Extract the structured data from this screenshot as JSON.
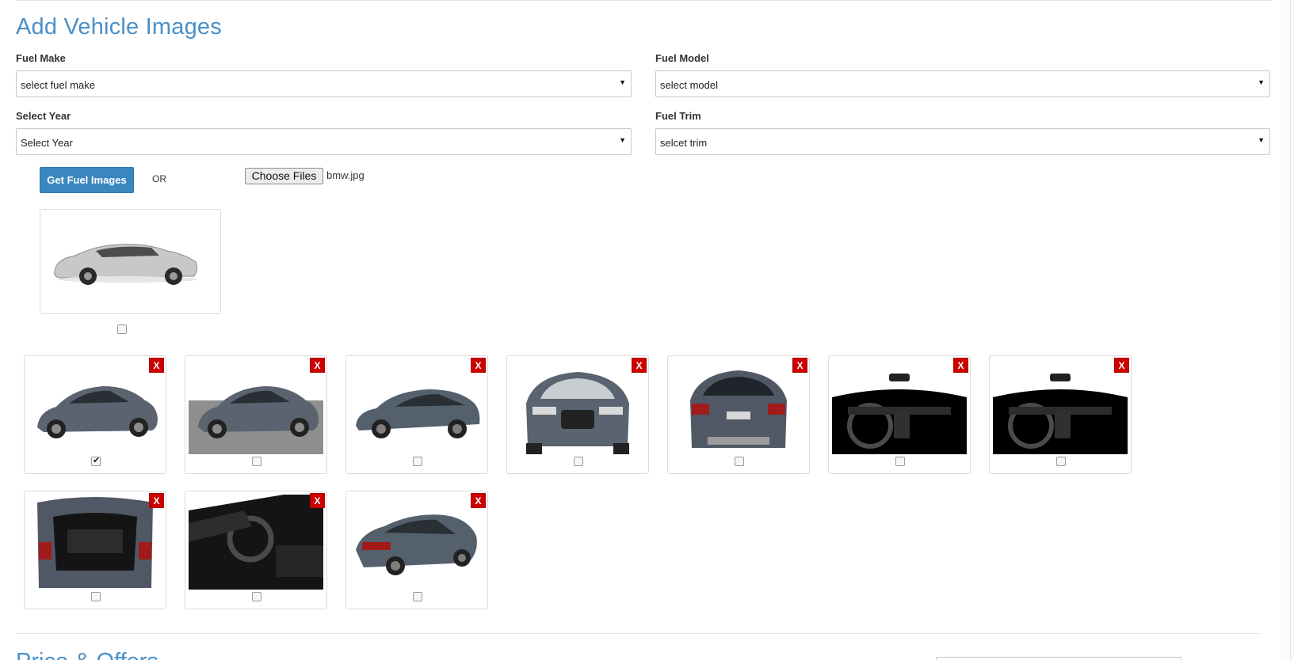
{
  "page": {
    "title": "Add Vehicle Images",
    "next_section_title": "Price & Offers"
  },
  "fields": {
    "make": {
      "label": "Fuel Make",
      "value": "select fuel make"
    },
    "model": {
      "label": "Fuel Model",
      "value": "select model"
    },
    "year": {
      "label": "Select Year",
      "value": "Select Year"
    },
    "trim": {
      "label": "Fuel Trim",
      "value": "selcet trim"
    }
  },
  "actions": {
    "get_images_label": "Get Fuel Images",
    "or_text": "OR",
    "choose_files_label": "Choose Files",
    "chosen_file": "bmw.jpg"
  },
  "icons": {
    "select_caret": "▼",
    "delete_label": "X"
  },
  "colors": {
    "accent": "#4a8fc7",
    "button": "#3a87c0",
    "delete": "#cc0000"
  },
  "uploaded_preview": {
    "checked": false
  },
  "thumbnails": [
    {
      "view": "front-three-quarter",
      "checked": true
    },
    {
      "view": "front-three-quarter-gray-bg",
      "checked": false
    },
    {
      "view": "side",
      "checked": false
    },
    {
      "view": "front",
      "checked": false
    },
    {
      "view": "rear",
      "checked": false
    },
    {
      "view": "dashboard",
      "checked": false
    },
    {
      "view": "dashboard",
      "checked": false
    },
    {
      "view": "cargo",
      "checked": false
    },
    {
      "view": "cockpit",
      "checked": false
    },
    {
      "view": "rear-three-quarter",
      "checked": false
    }
  ]
}
